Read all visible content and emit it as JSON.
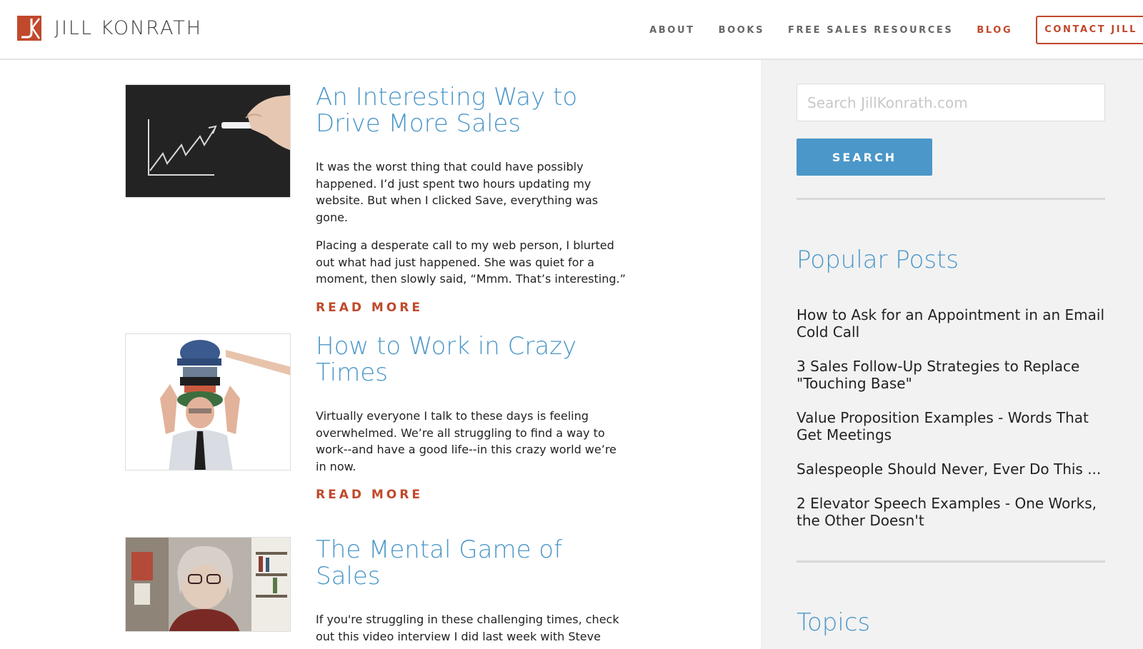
{
  "brand": {
    "name": "JILL KONRATH",
    "accent_color": "#c0492c",
    "link_color": "#4b97c9"
  },
  "nav": {
    "items": [
      {
        "label": "ABOUT"
      },
      {
        "label": "BOOKS"
      },
      {
        "label": "FREE SALES RESOURCES"
      },
      {
        "label": "BLOG",
        "active": true
      }
    ],
    "contact_label": "CONTACT JILL"
  },
  "posts": [
    {
      "title": "An Interesting Way to Drive More Sales",
      "paragraphs": [
        "It was the worst thing that could have possibly happened. I’d just spent two hours updating my website. But when I clicked Save, everything was gone.",
        "Placing a desperate call to my web person, I blurted out what had just happened. She was quiet for a moment, then slowly said, “Mmm. That’s interesting.”"
      ],
      "read_more": "READ MORE",
      "image": "chalkboard-growth-chart"
    },
    {
      "title": "How to Work in Crazy Times",
      "paragraphs": [
        "Virtually everyone I talk to these days is feeling overwhelmed. We’re all struggling to find a way to work--and have a good life--in this crazy world we’re in now."
      ],
      "read_more": "READ MORE",
      "image": "man-wearing-many-hats"
    },
    {
      "title": "The Mental Game of Sales",
      "paragraphs": [
        "If you're struggling in these challenging times, check out this video interview I did last week with Steve"
      ],
      "image": "video-interview-still"
    }
  ],
  "sidebar": {
    "search_placeholder": "Search JillKonrath.com",
    "search_button": "SEARCH",
    "popular_heading": "Popular Posts",
    "popular_posts": [
      "How to Ask for an Appointment in an Email Cold Call",
      "3 Sales Follow-Up Strategies to Replace \"Touching Base\"",
      "Value Proposition Examples - Words That Get Meetings",
      "Salespeople Should Never, Ever Do This ...",
      "2 Elevator Speech Examples - One Works, the Other Doesn't"
    ],
    "topics_heading": "Topics"
  }
}
